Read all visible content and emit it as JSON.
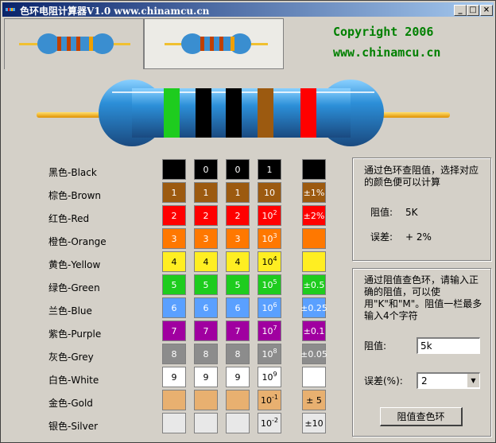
{
  "window": {
    "title": "色环电阻计算器V1.0   www.chinamcu.cn"
  },
  "header": {
    "copyright": "Copyright 2006",
    "website": "www.chinamcu.cn"
  },
  "colors": [
    {
      "name": "黑色-Black",
      "hex": "#000000",
      "digit": "",
      "digit_text": "0",
      "mult_base": "1",
      "mult_exp": "",
      "tol": ""
    },
    {
      "name": "棕色-Brown",
      "hex": "#9c5a10",
      "digit": "1",
      "digit_text": "1",
      "mult_base": "10",
      "mult_exp": "",
      "tol": "±1%"
    },
    {
      "name": "红色-Red",
      "hex": "#ff0000",
      "digit": "2",
      "digit_text": "2",
      "mult_base": "10",
      "mult_exp": "2",
      "tol": "±2%"
    },
    {
      "name": "橙色-Orange",
      "hex": "#ff7800",
      "digit": "3",
      "digit_text": "3",
      "mult_base": "10",
      "mult_exp": "3",
      "tol": ""
    },
    {
      "name": "黄色-Yellow",
      "hex": "#ffee22",
      "digit": "4",
      "digit_text": "4",
      "mult_base": "10",
      "mult_exp": "4",
      "tol": ""
    },
    {
      "name": "绿色-Green",
      "hex": "#1ecc1e",
      "digit": "5",
      "digit_text": "5",
      "mult_base": "10",
      "mult_exp": "5",
      "tol": "±0.5"
    },
    {
      "name": "兰色-Blue",
      "hex": "#5aa0ff",
      "digit": "6",
      "digit_text": "6",
      "mult_base": "10",
      "mult_exp": "6",
      "tol": "±0.25"
    },
    {
      "name": "紫色-Purple",
      "hex": "#a000a0",
      "digit": "7",
      "digit_text": "7",
      "mult_base": "10",
      "mult_exp": "7",
      "tol": "±0.1"
    },
    {
      "name": "灰色-Grey",
      "hex": "#8c8c8c",
      "digit": "8",
      "digit_text": "8",
      "mult_base": "10",
      "mult_exp": "8",
      "tol": "±0.05"
    },
    {
      "name": "白色-White",
      "hex": "#ffffff",
      "digit": "9",
      "digit_text": "9",
      "mult_base": "10",
      "mult_exp": "9",
      "tol": ""
    },
    {
      "name": "金色-Gold",
      "hex": "#e8b070",
      "digit": "",
      "digit_text": "",
      "mult_base": "10",
      "mult_exp": "-1",
      "tol": "± 5"
    },
    {
      "name": "银色-Silver",
      "hex": "#e8e8e8",
      "digit": "",
      "digit_text": "",
      "mult_base": "10",
      "mult_exp": "-2",
      "tol": "±10"
    }
  ],
  "bands_display": [
    "#1ecc1e",
    "#000000",
    "#000000",
    "#9c5a10",
    "#ff0000"
  ],
  "panel1": {
    "desc": "通过色环查阻值，选择对应的颜色便可以计算",
    "res_label": "阻值:",
    "res_value": "5K",
    "tol_label": "误差:",
    "tol_value": "+ 2%"
  },
  "panel2": {
    "desc": "通过阻值查色环，请输入正确的阻值，可以使用\"K\"和\"M\"。阻值一栏最多输入4个字符",
    "res_label": "阻值:",
    "res_input": "5k",
    "tol_label": "误差(%):",
    "tol_select": "2",
    "button": "阻值查色环"
  }
}
